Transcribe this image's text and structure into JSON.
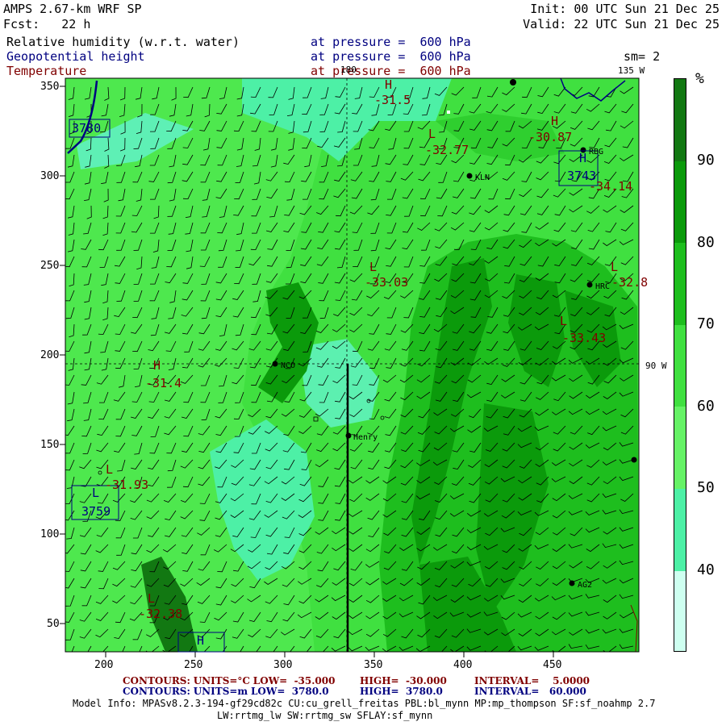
{
  "header": {
    "line1_left": "AMPS 2.67-km WRF SP",
    "line1_right": "Init: 00 UTC Sun 21 Dec 25",
    "line2_left": "Fcst:   22 h",
    "line2_right": "Valid: 22 UTC Sun 21 Dec 25",
    "fields": [
      {
        "name": "Relative humidity (w.r.t. water)",
        "level": "at pressure =  600 hPa",
        "color": "#000000"
      },
      {
        "name": "Geopotential height",
        "level": "at pressure =  600 hPa",
        "color": "#000080"
      },
      {
        "name": "Temperature",
        "level": "at pressure =  600 hPa",
        "color": "#800000"
      }
    ],
    "smoothing": "sm= 2"
  },
  "map": {
    "x_ticks": [
      "200",
      "250",
      "300",
      "350",
      "400",
      "450"
    ],
    "y_ticks": [
      "350",
      "300",
      "250",
      "200",
      "150",
      "100",
      "50"
    ],
    "lon_labels": {
      "top_180": "180",
      "top_135w": "135 W",
      "right_90w": "90 W"
    },
    "stations": [
      "KLN",
      "RBG",
      "HRC",
      "NCO",
      "Henry",
      "AG2"
    ],
    "height_boxes": [
      "3780",
      "3743",
      "3759"
    ],
    "pressure_letters": [
      "H",
      "L"
    ],
    "temp_labels": [
      "-31.5",
      "-30.87",
      "-32.77",
      "-34.14",
      "-33.03",
      "-32.8",
      "-33.43",
      "-31.4",
      "-31.93",
      "-32.38"
    ]
  },
  "colorbar": {
    "unit": "%",
    "labels": [
      "90",
      "80",
      "70",
      "60",
      "50",
      "40"
    ],
    "colors": [
      "#127812",
      "#0b9a0b",
      "#1ebe1e",
      "#40e040",
      "#66f266",
      "#4df0a6",
      "#cefff0"
    ]
  },
  "footer": {
    "temp_contours": {
      "label": "CONTOURS:",
      "units": "UNITS=°C",
      "low": "LOW=  -35.000",
      "high": "HIGH=  -30.000",
      "interval": "INTERVAL=    5.0000"
    },
    "height_contours": {
      "label": "CONTOURS:",
      "units": "UNITS=m",
      "low": "LOW=  3780.0",
      "high": "HIGH=  3780.0",
      "interval": "INTERVAL=   60.000"
    },
    "model_info": "Model Info: MPASv8.2.3-194-gf29cd82c CU:cu_grell_freitas PBL:bl_mynn MP:mp_thompson SF:sf_noahmp 2.7",
    "model_info2": "LW:rrtmg_lw SW:rrtmg_sw SFLAY:sf_mynn"
  }
}
